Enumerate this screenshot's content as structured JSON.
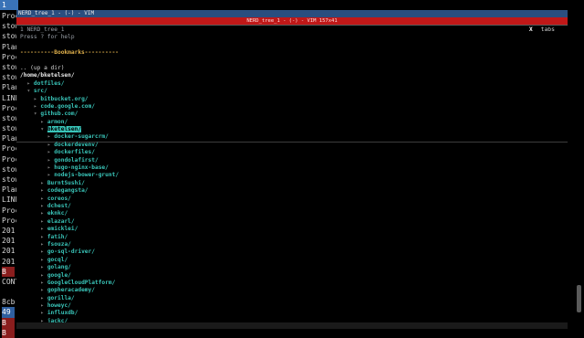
{
  "background_terminal": {
    "tab_label": "1",
    "lines": [
      "Proc",
      "stow",
      "stow",
      "Plan",
      "Proc",
      "stow",
      "stow",
      "Plan",
      "LINE",
      "Proc",
      "stow",
      "stow",
      "Plan",
      "Proc",
      "Proc",
      "stow",
      "stow",
      "Plan",
      "LINE",
      "Proc",
      "Proc",
      "201",
      "201",
      "201",
      "201",
      "B",
      "CONT",
      "",
      "8cb",
      "49",
      "B",
      "B"
    ]
  },
  "vim": {
    "window_title": "NERD_tree_1 - (-) - VIM",
    "tabline_text": "NERD_tree_1 - (-) - VIM 157x41",
    "tabs_close": "X",
    "tabs_label": "tabs",
    "help_lines": [
      "1 NERD_tree_1",
      "Press ? for help"
    ],
    "bookmarks_header": "----------Bookmarks----------",
    "up_dir": ".. (up a dir)",
    "root_path": "/home/bketelsen/",
    "tree": [
      {
        "indent": 0,
        "arrow": "▸",
        "name": "dotfiles/"
      },
      {
        "indent": 0,
        "arrow": "▾",
        "name": "src/"
      },
      {
        "indent": 1,
        "arrow": "▸",
        "name": "bitbucket.org/"
      },
      {
        "indent": 1,
        "arrow": "▸",
        "name": "code.google.com/"
      },
      {
        "indent": 1,
        "arrow": "▾",
        "name": "github.com/"
      },
      {
        "indent": 2,
        "arrow": "▸",
        "name": "armon/"
      },
      {
        "indent": 2,
        "arrow": "▾",
        "name": "bketelsen/",
        "cursor": true
      },
      {
        "indent": 3,
        "arrow": "▸",
        "name": "docker-sugarcrm/"
      },
      {
        "indent": 3,
        "arrow": "▸",
        "name": "dockerdevenv/"
      },
      {
        "indent": 3,
        "arrow": "▸",
        "name": "dockerfiles/"
      },
      {
        "indent": 3,
        "arrow": "▸",
        "name": "gondolafirst/"
      },
      {
        "indent": 3,
        "arrow": "▸",
        "name": "hugo-nginx-base/"
      },
      {
        "indent": 3,
        "arrow": "▸",
        "name": "nodejs-bower-grunt/"
      },
      {
        "indent": 2,
        "arrow": "▸",
        "name": "BurntSushi/"
      },
      {
        "indent": 2,
        "arrow": "▸",
        "name": "codegangsta/"
      },
      {
        "indent": 2,
        "arrow": "▸",
        "name": "coreos/"
      },
      {
        "indent": 2,
        "arrow": "▸",
        "name": "dchest/"
      },
      {
        "indent": 2,
        "arrow": "▸",
        "name": "eknkc/"
      },
      {
        "indent": 2,
        "arrow": "▸",
        "name": "elazarl/"
      },
      {
        "indent": 2,
        "arrow": "▸",
        "name": "emicklei/"
      },
      {
        "indent": 2,
        "arrow": "▸",
        "name": "fatih/"
      },
      {
        "indent": 2,
        "arrow": "▸",
        "name": "fsouza/"
      },
      {
        "indent": 2,
        "arrow": "▸",
        "name": "go-sql-driver/"
      },
      {
        "indent": 2,
        "arrow": "▸",
        "name": "gocql/"
      },
      {
        "indent": 2,
        "arrow": "▸",
        "name": "golang/"
      },
      {
        "indent": 2,
        "arrow": "▸",
        "name": "google/"
      },
      {
        "indent": 2,
        "arrow": "▸",
        "name": "GoogleCloudPlatform/"
      },
      {
        "indent": 2,
        "arrow": "▸",
        "name": "gopheracademy/"
      },
      {
        "indent": 2,
        "arrow": "▸",
        "name": "gorilla/"
      },
      {
        "indent": 2,
        "arrow": "▸",
        "name": "howeyc/"
      },
      {
        "indent": 2,
        "arrow": "▸",
        "name": "influxdb/"
      },
      {
        "indent": 2,
        "arrow": "▸",
        "name": "jackc/"
      }
    ],
    "colors": {
      "directory": "#39c5b9",
      "bookmark_header": "#e0b04b",
      "tabline": "#c01818",
      "title_bar": "#2a4e7f"
    }
  }
}
